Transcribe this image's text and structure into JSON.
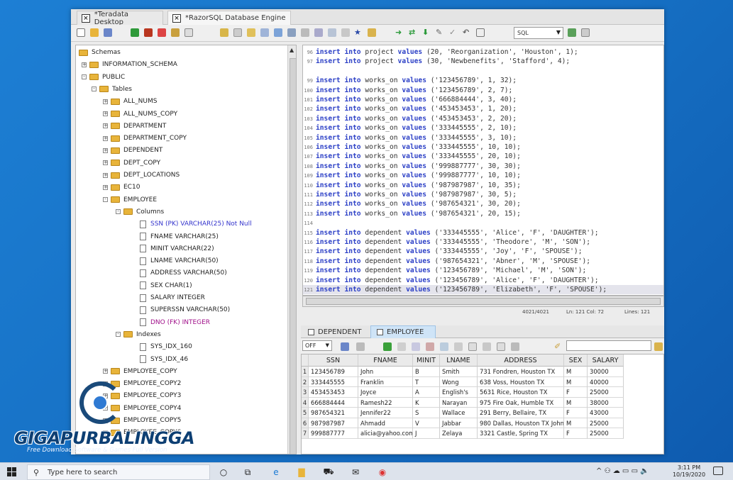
{
  "tabs": [
    {
      "label": "*Teradata Desktop",
      "active": false
    },
    {
      "label": "*RazorSQL Database Engine",
      "active": true
    }
  ],
  "toolbar": {
    "sql_select": "SQL"
  },
  "tree": [
    {
      "label": "Schemas",
      "level": 0,
      "type": "root"
    },
    {
      "label": "INFORMATION_SCHEMA",
      "level": 1,
      "type": "folder",
      "exp": "+"
    },
    {
      "label": "PUBLIC",
      "level": 1,
      "type": "folder",
      "exp": "-"
    },
    {
      "label": "Tables",
      "level": 2,
      "type": "folder",
      "exp": "-"
    },
    {
      "label": "ALL_NUMS",
      "level": 3,
      "type": "folder",
      "exp": "+"
    },
    {
      "label": "ALL_NUMS_COPY",
      "level": 3,
      "type": "folder",
      "exp": "+"
    },
    {
      "label": "DEPARTMENT",
      "level": 3,
      "type": "folder",
      "exp": "+"
    },
    {
      "label": "DEPARTMENT_COPY",
      "level": 3,
      "type": "folder",
      "exp": "+"
    },
    {
      "label": "DEPENDENT",
      "level": 3,
      "type": "folder",
      "exp": "+"
    },
    {
      "label": "DEPT_COPY",
      "level": 3,
      "type": "folder",
      "exp": "+"
    },
    {
      "label": "DEPT_LOCATIONS",
      "level": 3,
      "type": "folder",
      "exp": "+"
    },
    {
      "label": "EC10",
      "level": 3,
      "type": "folder",
      "exp": "+"
    },
    {
      "label": "EMPLOYEE",
      "level": 3,
      "type": "folder",
      "exp": "-"
    },
    {
      "label": "Columns",
      "level": 4,
      "type": "folder",
      "exp": "-"
    },
    {
      "label": "SSN (PK) VARCHAR(25) Not Null",
      "level": 5,
      "type": "col",
      "kind": "pk"
    },
    {
      "label": "FNAME VARCHAR(25)",
      "level": 5,
      "type": "col"
    },
    {
      "label": "MINIT VARCHAR(22)",
      "level": 5,
      "type": "col"
    },
    {
      "label": "LNAME VARCHAR(50)",
      "level": 5,
      "type": "col"
    },
    {
      "label": "ADDRESS VARCHAR(50)",
      "level": 5,
      "type": "col"
    },
    {
      "label": "SEX CHAR(1)",
      "level": 5,
      "type": "col"
    },
    {
      "label": "SALARY INTEGER",
      "level": 5,
      "type": "col"
    },
    {
      "label": "SUPERSSN VARCHAR(50)",
      "level": 5,
      "type": "col"
    },
    {
      "label": "DNO (FK) INTEGER",
      "level": 5,
      "type": "col",
      "kind": "fk"
    },
    {
      "label": "Indexes",
      "level": 4,
      "type": "folder",
      "exp": "-"
    },
    {
      "label": "SYS_IDX_160",
      "level": 5,
      "type": "col"
    },
    {
      "label": "SYS_IDX_46",
      "level": 5,
      "type": "col"
    },
    {
      "label": "EMPLOYEE_COPY",
      "level": 3,
      "type": "folder",
      "exp": "+"
    },
    {
      "label": "EMPLOYEE_COPY2",
      "level": 3,
      "type": "folder",
      "exp": "+"
    },
    {
      "label": "EMPLOYEE_COPY3",
      "level": 3,
      "type": "folder",
      "exp": "+"
    },
    {
      "label": "EMPLOYEE_COPY4",
      "level": 3,
      "type": "folder",
      "exp": "+"
    },
    {
      "label": "EMPLOYEE_COPY5",
      "level": 3,
      "type": "folder",
      "exp": "+"
    },
    {
      "label": "EMPLOYEE_COPY6",
      "level": 3,
      "type": "folder",
      "exp": "+"
    }
  ],
  "code": [
    {
      "n": "96",
      "t": "project",
      "v": "20, 'Reorganization', 'Houston', 1);"
    },
    {
      "n": "97",
      "t": "project",
      "v": "30, 'Newbenefits', 'Stafford', 4);"
    },
    {
      "n": "",
      "t": "",
      "v": ""
    },
    {
      "n": "99",
      "t": "works_on",
      "v": "'123456789', 1, 32);"
    },
    {
      "n": "100",
      "t": "works_on",
      "v": "'123456789', 2, 7);"
    },
    {
      "n": "101",
      "t": "works_on",
      "v": "'666884444', 3, 40);"
    },
    {
      "n": "102",
      "t": "works_on",
      "v": "'453453453', 1, 20);"
    },
    {
      "n": "103",
      "t": "works_on",
      "v": "'453453453', 2, 20);"
    },
    {
      "n": "104",
      "t": "works_on",
      "v": "'333445555', 2, 10);"
    },
    {
      "n": "105",
      "t": "works_on",
      "v": "'333445555', 3, 10);"
    },
    {
      "n": "106",
      "t": "works_on",
      "v": "'333445555', 10, 10);"
    },
    {
      "n": "107",
      "t": "works_on",
      "v": "'333445555', 20, 10);"
    },
    {
      "n": "108",
      "t": "works_on",
      "v": "'999887777', 30, 30);"
    },
    {
      "n": "109",
      "t": "works_on",
      "v": "'999887777', 10, 10);"
    },
    {
      "n": "110",
      "t": "works_on",
      "v": "'987987987', 10, 35);"
    },
    {
      "n": "111",
      "t": "works_on",
      "v": "'987987987', 30, 5);"
    },
    {
      "n": "112",
      "t": "works_on",
      "v": "'987654321', 30, 20);"
    },
    {
      "n": "113",
      "t": "works_on",
      "v": "'987654321', 20, 15);"
    },
    {
      "n": "114",
      "t": "",
      "v": ""
    },
    {
      "n": "115",
      "t": "dependent",
      "v": "'333445555', 'Alice', 'F', 'DAUGHTER');"
    },
    {
      "n": "116",
      "t": "dependent",
      "v": "'333445555', 'Theodore', 'M', 'SON');"
    },
    {
      "n": "117",
      "t": "dependent",
      "v": "'333445555', 'Joy', 'F', 'SPOUSE');"
    },
    {
      "n": "118",
      "t": "dependent",
      "v": "'987654321', 'Abner', 'M', 'SPOUSE');"
    },
    {
      "n": "119",
      "t": "dependent",
      "v": "'123456789', 'Michael', 'M', 'SON');"
    },
    {
      "n": "120",
      "t": "dependent",
      "v": "'123456789', 'Alice', 'F', 'DAUGHTER');"
    },
    {
      "n": "121",
      "t": "dependent",
      "v": "'123456789', 'Elizabeth', 'F', 'SPOUSE');"
    }
  ],
  "keywords": {
    "insert": "insert",
    "into": "into",
    "values": "values"
  },
  "status": {
    "pos": "4021/4021",
    "lncol": "Ln: 121 Col: 72",
    "lines": "Lines: 121"
  },
  "result_tabs": [
    {
      "label": "DEPENDENT",
      "active": false
    },
    {
      "label": "EMPLOYEE",
      "active": true
    }
  ],
  "result_toolbar": {
    "off_select": "OFF"
  },
  "grid": {
    "columns": [
      "SSN",
      "FNAME",
      "MINIT",
      "LNAME",
      "ADDRESS",
      "SEX",
      "SALARY"
    ],
    "rows": [
      [
        "1",
        "123456789",
        "John",
        "B",
        "Smith",
        "731 Fondren, Houston TX",
        "M",
        "30000"
      ],
      [
        "2",
        "333445555",
        "Franklin",
        "T",
        "Wong",
        "638 Voss, Houston TX",
        "M",
        "40000"
      ],
      [
        "3",
        "453453453",
        "Joyce",
        "A",
        "English's",
        "5631 Rice, Houston TX",
        "F",
        "25000"
      ],
      [
        "4",
        "666884444",
        "Ramesh22",
        "K",
        "Narayan",
        "975 Fire Oak, Humble TX",
        "M",
        "38000"
      ],
      [
        "5",
        "987654321",
        "Jennifer22",
        "S",
        "Wallace",
        "291 Berry, Bellaire, TX",
        "F",
        "43000"
      ],
      [
        "6",
        "987987987",
        "Ahmadd",
        "V",
        "Jabbar",
        "980 Dallas, Houston TX John",
        "M",
        "25000"
      ],
      [
        "7",
        "999887777",
        "alicia@yahoo.com",
        "J",
        "Zelaya",
        "3321 Castle, Spring TX",
        "F",
        "25000"
      ]
    ]
  },
  "watermark": {
    "title": "GIGAPURBALINGGA",
    "subtitle": "Free Download Software & Games Full Version"
  },
  "taskbar": {
    "search_placeholder": "Type here to search",
    "time": "3:11 PM",
    "date": "10/19/2020"
  },
  "colors": {
    "keyword": "#2b3fc6",
    "pk": "#3333cc",
    "fk": "#a0108a",
    "desktop": "#1670c4"
  }
}
